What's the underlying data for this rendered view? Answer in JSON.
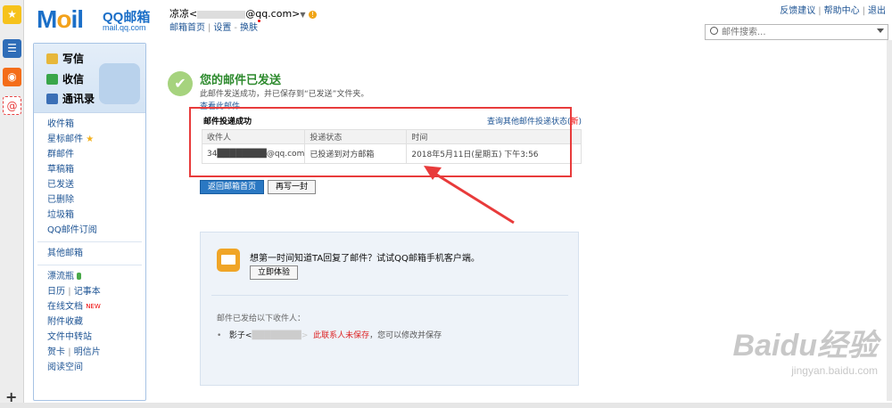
{
  "rail": {
    "icons": [
      "star-icon",
      "layout-icon",
      "weibo-icon",
      "mail-at-icon"
    ],
    "add_label": "+"
  },
  "header": {
    "logo_main": "M",
    "logo_mid": "i",
    "logo_end": "l",
    "logo_brand": "QQ邮箱",
    "logo_domain": "mail.qq.com",
    "account": "凉凉<",
    "account_email": "@qq.com>",
    "account_arrow": "▼",
    "account_warn": "!",
    "links": {
      "home": "邮箱首页",
      "settings": "设置",
      "skin": "换肤"
    },
    "right_links": {
      "feedback": "反馈建议",
      "help": "帮助中心",
      "logout": "退出"
    },
    "search_placeholder": "邮件搜索..."
  },
  "sidebar": {
    "primary": {
      "write": "写信",
      "inbox": "收信",
      "contacts": "通讯录"
    },
    "folders": [
      "收件箱",
      "星标邮件",
      "群邮件",
      "草稿箱",
      "已发送",
      "已删除",
      "垃圾箱",
      "QQ邮件订阅"
    ],
    "other": "其他邮箱",
    "extras": {
      "drift": "漂流瓶",
      "calendar": "日历",
      "notes": "记事本",
      "docs": "在线文档",
      "docs_badge": "NEW",
      "attachments": "附件收藏",
      "transfer": "文件中转站",
      "cards": "贺卡",
      "postcards": "明信片",
      "reading": "阅读空间"
    }
  },
  "main": {
    "title": "您的邮件已发送",
    "subtitle": "此邮件发送成功，并已保存到“已发送”文件夹。",
    "view_link": "查看此邮件",
    "status_card": {
      "heading": "邮件投递成功",
      "query_link": "查询其他邮件投递状态(",
      "query_new": "新",
      "query_close": ")",
      "columns": [
        "收件人",
        "投递状态",
        "时间"
      ],
      "row": [
        "34████████@qq.com",
        "已投递到对方邮箱",
        "2018年5月11日(星期五) 下午3:56"
      ]
    },
    "buttons": {
      "back": "返回邮箱首页",
      "again": "再写一封"
    },
    "promo": {
      "text": "想第一时间知道TA回复了邮件？试试QQ邮箱手机客户端。",
      "try_button": "立即体验",
      "sent_to": "邮件已发给以下收件人：",
      "recipient_name": "影子<",
      "recipient_tail": "████████>",
      "unsaved_warning": "此联系人未保存",
      "unsaved_hint": "，您可以修改并保存"
    }
  },
  "watermark": {
    "main": "Baidu经验",
    "sub": "jingyan.baidu.com"
  },
  "colors": {
    "accent": "#2a78c3",
    "success": "#2d8a2d",
    "highlight_box": "#e83b3b"
  }
}
